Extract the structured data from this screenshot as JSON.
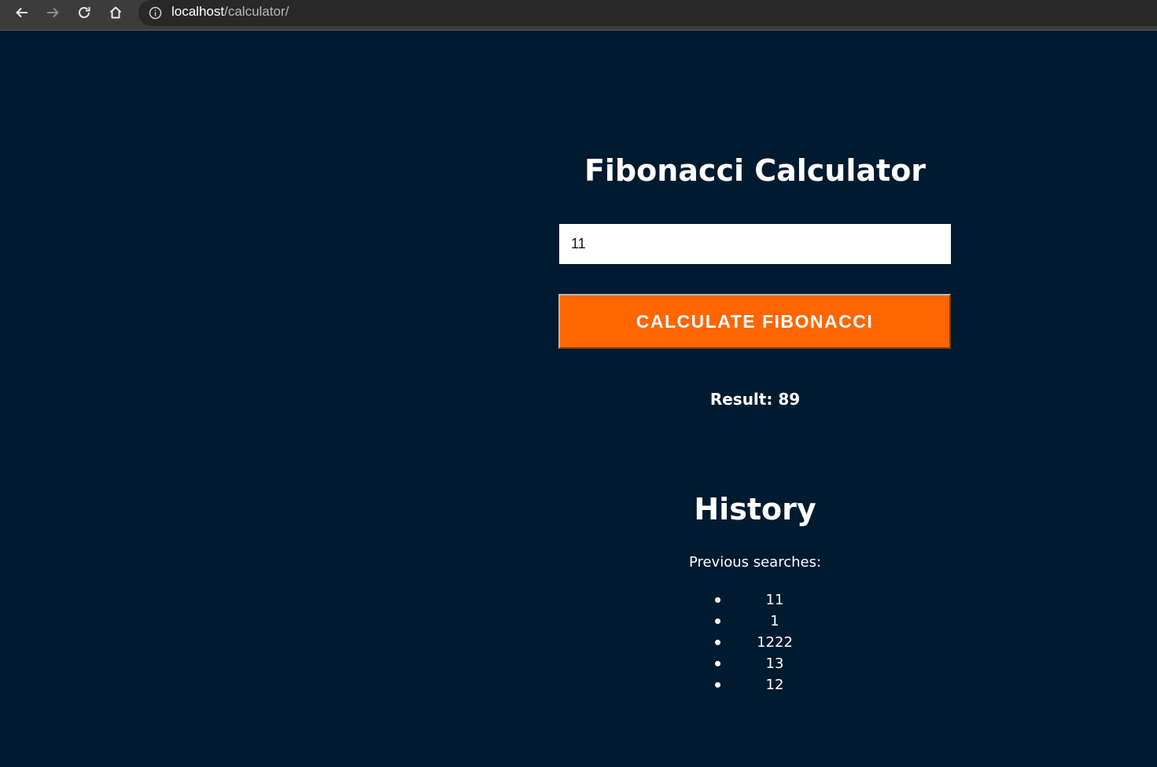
{
  "browser": {
    "url_host": "localhost",
    "url_path": "/calculator/"
  },
  "calculator": {
    "title": "Fibonacci Calculator",
    "input_value": "11",
    "button_label": "CALCULATE FIBONACCI",
    "result_text": "Result: 89"
  },
  "history": {
    "title": "History",
    "subtitle": "Previous searches:",
    "items": [
      "11",
      "1",
      "1222",
      "13",
      "12"
    ]
  },
  "colors": {
    "background": "#001a30",
    "accent": "#ff6600"
  }
}
